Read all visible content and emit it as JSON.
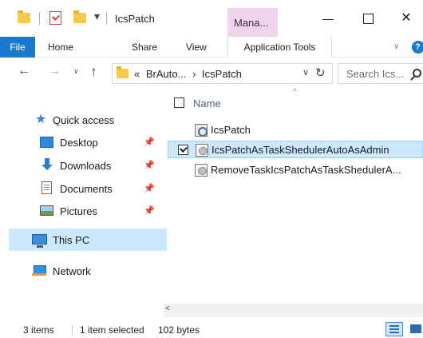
{
  "window": {
    "title": "IcsPatch",
    "qa_dropdown_glyph": "▾",
    "context_tab_label": "Mana...",
    "close_glyph": "✕"
  },
  "ribbon": {
    "tabs": [
      "File",
      "Home",
      "Share",
      "View",
      "Application Tools"
    ],
    "collapse_glyph": "∨",
    "help_glyph": "?"
  },
  "navigation": {
    "back_glyph": "←",
    "forward_glyph": "→",
    "recent_glyph": "∨",
    "up_glyph": "↑",
    "breadcrumb": [
      "«",
      "BrAuto...",
      "›",
      "IcsPatch"
    ],
    "dropdown_glyph": "∨",
    "refresh_glyph": "↻",
    "search_placeholder": "Search Ics..."
  },
  "nav_pane": {
    "quick_access": "Quick access",
    "pinned": [
      "Desktop",
      "Downloads",
      "Documents",
      "Pictures"
    ],
    "pin_glyph": "📌",
    "this_pc": "This PC",
    "network": "Network"
  },
  "file_list": {
    "sort_glyph": "^",
    "column_name": "Name",
    "files": [
      "IcsPatch",
      "IcsPatchAsTaskShedulerAutoAsAdmin",
      "RemoveTaskIcsPatchAsTaskShedulerA..."
    ],
    "selected_index": 1,
    "scroll_left_glyph": "<"
  },
  "status_bar": {
    "items_count": "3 items",
    "selection": "1 item selected",
    "size": "102 bytes"
  },
  "colors": {
    "accent": "#1979ca",
    "selection": "#cce8ff",
    "context_tab": "#f0d4ee",
    "folder": "#f7c948"
  }
}
